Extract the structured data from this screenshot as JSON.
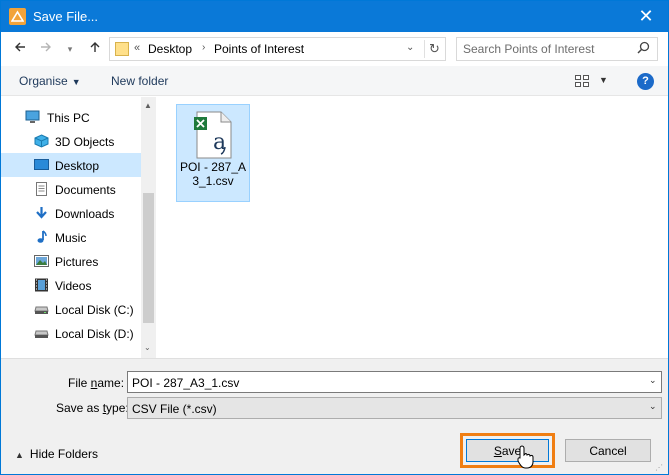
{
  "window": {
    "title": "Save File...",
    "close_glyph": "✕"
  },
  "address": {
    "recent_glyph": "▾",
    "overflow": "«",
    "crumbs": [
      "Desktop",
      "Points of Interest"
    ],
    "separator": "›",
    "dropdown_glyph": "⌄",
    "refresh_glyph": "↻"
  },
  "search": {
    "placeholder": "Search Points of Interest",
    "icon": "search-icon"
  },
  "toolbar": {
    "organise_label": "Organise",
    "organise_caret": "▼",
    "new_folder_label": "New folder",
    "view_caret": "▼",
    "help_label": "?"
  },
  "nav": {
    "items": [
      {
        "label": "This PC",
        "icon": "computer-icon"
      },
      {
        "label": "3D Objects",
        "icon": "cube-icon"
      },
      {
        "label": "Desktop",
        "icon": "desktop-icon"
      },
      {
        "label": "Documents",
        "icon": "document-icon"
      },
      {
        "label": "Downloads",
        "icon": "download-arrow-icon"
      },
      {
        "label": "Music",
        "icon": "music-note-icon"
      },
      {
        "label": "Pictures",
        "icon": "picture-icon"
      },
      {
        "label": "Videos",
        "icon": "film-icon"
      },
      {
        "label": "Local Disk (C:)",
        "icon": "drive-icon"
      },
      {
        "label": "Local Disk (D:)",
        "icon": "drive-icon"
      }
    ],
    "selected": "Desktop",
    "scroll_up_glyph": "▲",
    "scroll_down_glyph": "⌄"
  },
  "files": [
    {
      "name": "POI - 287_A3_1.csv",
      "icon": "csv-file-icon",
      "selected": true
    }
  ],
  "form": {
    "file_name_label_pre": "File ",
    "file_name_label_u": "n",
    "file_name_label_post": "ame:",
    "file_name_value": "POI - 287_A3_1.csv",
    "save_type_label_pre": "Save as ",
    "save_type_label_u": "t",
    "save_type_label_post": "ype:",
    "save_type_value": "CSV File (*.csv)",
    "dropdown_glyph": "⌄"
  },
  "footer": {
    "hide_folders_caret": "▲",
    "hide_folders_label": "Hide Folders",
    "save_label_u": "S",
    "save_label_rest": "ave",
    "cancel_label": "Cancel",
    "grip_glyph": "⋰"
  },
  "colors": {
    "titlebar": "#0a79d8",
    "selection": "#cce8ff",
    "highlight": "#f07e12",
    "accent": "#0078d7"
  }
}
